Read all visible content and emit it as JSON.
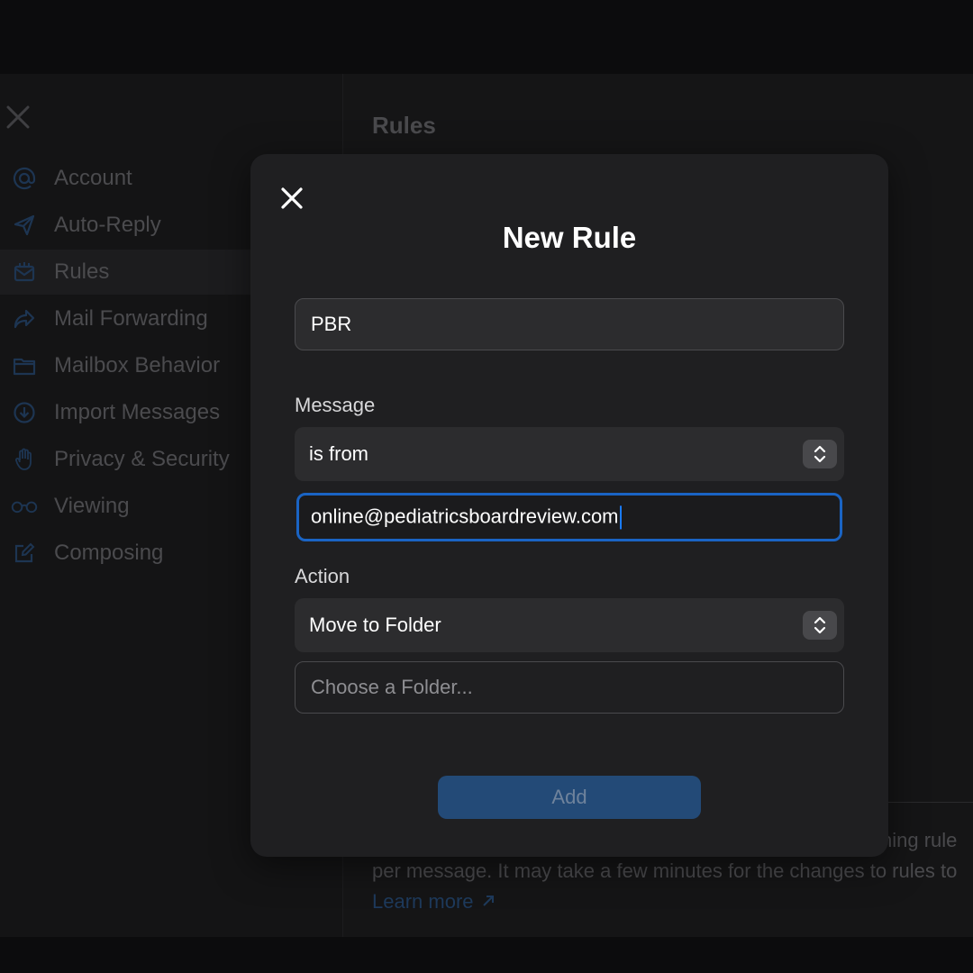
{
  "settings": {
    "sidebar": {
      "items": [
        {
          "label": "Account",
          "icon": "at-icon"
        },
        {
          "label": "Auto-Reply",
          "icon": "paper-plane-icon"
        },
        {
          "label": "Rules",
          "icon": "envelope-rules-icon"
        },
        {
          "label": "Mail Forwarding",
          "icon": "forward-arrow-icon"
        },
        {
          "label": "Mailbox Behavior",
          "icon": "folder-icon"
        },
        {
          "label": "Import Messages",
          "icon": "import-icon"
        },
        {
          "label": "Privacy & Security",
          "icon": "hand-icon"
        },
        {
          "label": "Viewing",
          "icon": "glasses-icon"
        },
        {
          "label": "Composing",
          "icon": "compose-icon"
        }
      ],
      "active": "Rules"
    },
    "main": {
      "title": "Rules",
      "info_line_1": "hing rule",
      "info_line_2": "per message. It may take a few minutes for the changes to rules to",
      "learn_more": "Learn more"
    }
  },
  "modal": {
    "title": "New Rule",
    "name_value": "PBR",
    "message_label": "Message",
    "condition_selected": "is from",
    "email_value": "online@pediatricsboardreview.com",
    "action_label": "Action",
    "action_selected": "Move to Folder",
    "folder_placeholder": "Choose a Folder...",
    "add_label": "Add"
  },
  "colors": {
    "accent": "#1a64c4",
    "button_bg": "#234a77",
    "modal_bg": "#1f1f21"
  }
}
